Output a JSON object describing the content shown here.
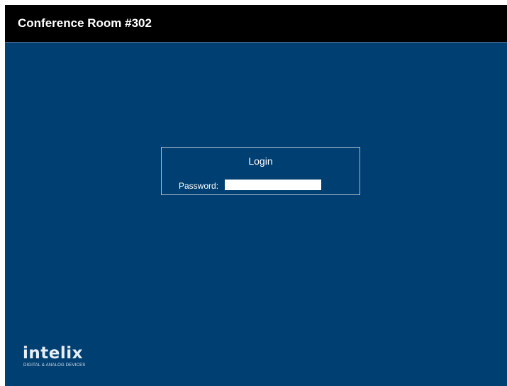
{
  "header": {
    "title": "Conference Room #302"
  },
  "login": {
    "title": "Login",
    "password_label": "Password:",
    "password_value": ""
  },
  "brand": {
    "logo_text": "intelix",
    "tagline": "DIGITAL & ANALOG DEVICES"
  },
  "colors": {
    "background": "#003f72",
    "header_bg": "#000000",
    "box_border": "#a9bdd2",
    "text": "#ffffff"
  }
}
